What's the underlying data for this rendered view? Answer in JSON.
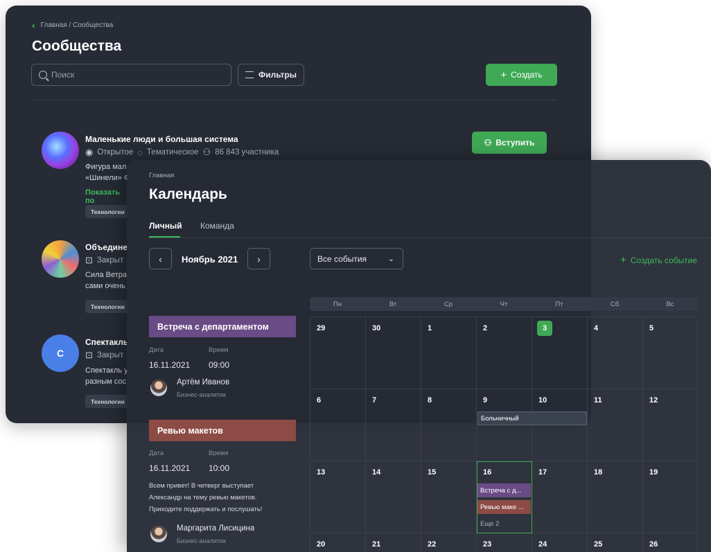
{
  "communities": {
    "breadcrumb": "Главная / Сообщества",
    "title": "Сообщества",
    "search_placeholder": "Поиск",
    "filters_label": "Фильтры",
    "create_label": "Создать",
    "join_label": "Вступить",
    "items": [
      {
        "name": "Маленькие люди и большая система",
        "type": "Открытое",
        "category": "Тематическое",
        "members": "86 843 участника",
        "desc_line1": "Фигура мал",
        "desc_line2": "«Шинели» Ф",
        "show_more": "Показать по",
        "tag": "Технологии"
      },
      {
        "name": "Объедине",
        "type": "Закрыт",
        "desc_line1": "Сила Ветра",
        "desc_line2": "сами очень",
        "tag": "Технологии"
      },
      {
        "name": "Спектакль",
        "avatar_letter": "С",
        "type": "Закрыт",
        "desc_line1": "Спектакль у",
        "desc_line2": "разным сос",
        "tag": "Технологии"
      }
    ]
  },
  "calendar": {
    "breadcrumb": "Главная",
    "title": "Календарь",
    "tabs": [
      "Личный",
      "Команда"
    ],
    "month": "Ноябрь 2021",
    "filter_value": "Все события",
    "create_event": "Создать событие",
    "weekdays": [
      "Пн",
      "Вт",
      "Ср",
      "Чт",
      "Пт",
      "Сб",
      "Вс"
    ],
    "days": [
      "29",
      "30",
      "1",
      "2",
      "3",
      "4",
      "5",
      "6",
      "7",
      "8",
      "9",
      "10",
      "11",
      "12",
      "13",
      "14",
      "15",
      "16",
      "17",
      "18",
      "19",
      "20",
      "21",
      "22",
      "23",
      "24",
      "25",
      "26"
    ],
    "today": "3",
    "selected": "16",
    "chips": {
      "sick": "Больничный",
      "meet": "Встреча с д...",
      "review": "Ревью маке ...",
      "more": "Еще 2"
    },
    "events": [
      {
        "title": "Встреча с департаментом",
        "date_label": "Дата",
        "time_label": "Время",
        "date": "16.11.2021",
        "time": "09:00",
        "person": "Артём Иванов",
        "role": "Бизнес-аналитик"
      },
      {
        "title": "Ревью макетов",
        "date_label": "Дата",
        "time_label": "Время",
        "date": "16.11.2021",
        "time": "10:00",
        "text1": "Всем привет! В четверг выступает",
        "text2": "Александр на тему ревью макетов.",
        "text3": "Приходите поддержать и послушать!",
        "person": "Маргарита Лисицина",
        "role": "Бизнес-аналитик"
      }
    ]
  },
  "colors": {
    "accent": "#3fa956",
    "bg": "#262b35",
    "event_purple": "#6a4b86",
    "event_red": "#8c4b44"
  }
}
